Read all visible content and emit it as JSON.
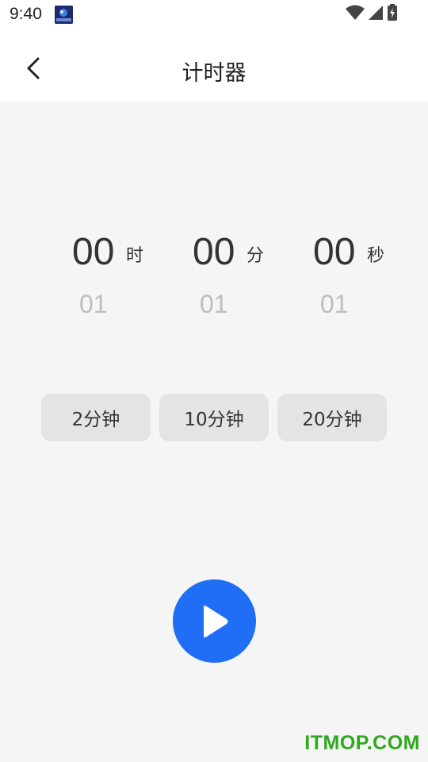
{
  "status_bar": {
    "time": "9:40",
    "icons": [
      "app-notification-icon",
      "wifi-icon",
      "cellular-signal-icon",
      "battery-charging-icon"
    ]
  },
  "nav": {
    "title": "计时器",
    "back_icon": "chevron-left-icon"
  },
  "picker": {
    "hours": {
      "value": "00",
      "unit": "时",
      "next": "01"
    },
    "minutes": {
      "value": "00",
      "unit": "分",
      "next": "01"
    },
    "seconds": {
      "value": "00",
      "unit": "秒",
      "next": "01"
    }
  },
  "presets": [
    {
      "label": "2分钟"
    },
    {
      "label": "10分钟"
    },
    {
      "label": "20分钟"
    }
  ],
  "controls": {
    "play_icon": "play-icon",
    "accent_color": "#1f6ef5"
  },
  "watermark": "ITMOP.COM"
}
